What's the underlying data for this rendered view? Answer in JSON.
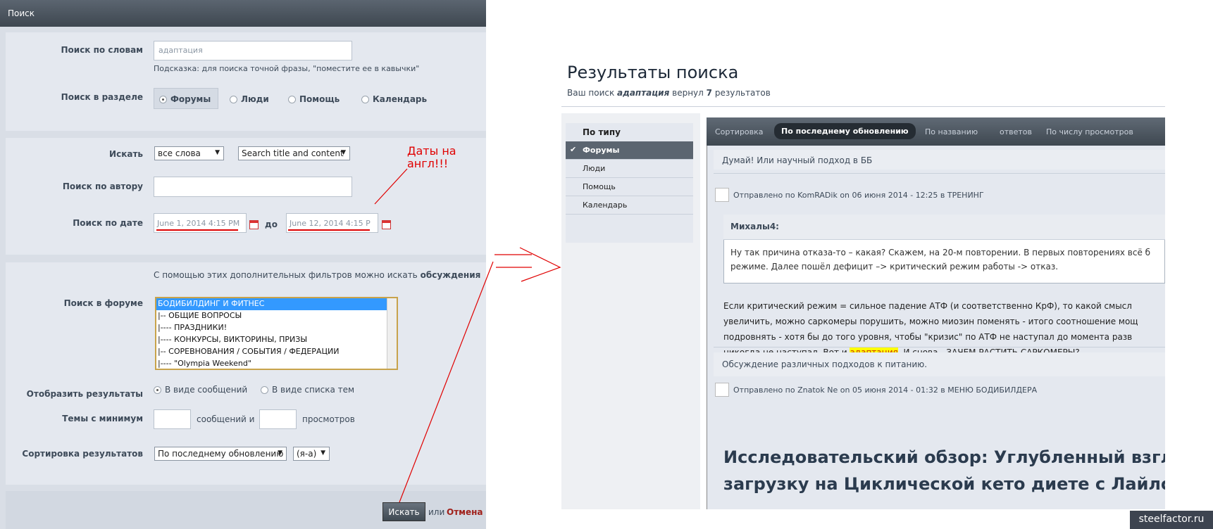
{
  "form": {
    "title": "Поиск",
    "words_label": "Поиск по словам",
    "words_value": "адаптация",
    "words_hint": "Подсказка: для поиска точной фразы, \"поместите ее в кавычки\"",
    "section_label": "Поиск в разделе",
    "sections": [
      "Форумы",
      "Люди",
      "Помощь",
      "Календарь"
    ],
    "search_label": "Искать",
    "search_mode": "все слова",
    "search_scope": "Search title and content",
    "author_label": "Поиск по автору",
    "author_value": "",
    "date_label": "Поиск по дате",
    "date_from": "June 1, 2014 4:15 PM",
    "date_to_label": "до",
    "date_to": "June 12, 2014 4:15 P",
    "filters_note": "С помощью этих дополнительных фильтров можно искать",
    "filters_note_bold": "обсуждения",
    "forum_label": "Поиск в форуме",
    "forums": [
      "БОДИБИЛДИНГ И ФИТНЕС",
      " |-- ОБЩИЕ ВОПРОСЫ",
      " |---- ПРАЗДНИКИ!",
      " |---- КОНКУРСЫ, ВИКТОРИНЫ, ПРИЗЫ",
      " |-- СОРЕВНОВАНИЯ / СОБЫТИЯ / ФЕДЕРАЦИИ",
      " |---- \"Olympia Weekend\""
    ],
    "display_label": "Отобразить результаты",
    "display_options": [
      "В виде сообщений",
      "В виде списка тем"
    ],
    "min_label": "Темы с минимум",
    "min_posts_suffix": "сообщений и",
    "min_views_suffix": "просмотров",
    "sort_label": "Сортировка результатов",
    "sort_value": "По последнему обновлению",
    "sort_order": "(я-а)",
    "search_button": "Искать",
    "or_text": "или",
    "cancel_link": "Отмена"
  },
  "annotation": {
    "line1": "Даты на",
    "line2": "англ!!!"
  },
  "results": {
    "title": "Результаты поиска",
    "summary_prefix": "Ваш поиск",
    "summary_query": "адаптация",
    "summary_mid": "вернул",
    "summary_count": "7",
    "summary_suffix": "результатов",
    "tabs_header": "По типу",
    "tabs": [
      "Форумы",
      "Люди",
      "Помощь",
      "Календарь"
    ],
    "sort_label": "Сортировка",
    "sort_active": "По последнему обновлению",
    "sort_options": [
      "По названию",
      "ответов",
      "По числу просмотров"
    ],
    "post1": {
      "title": "Думай! Или научный подход в ББ",
      "meta": "Отправлено по KomRADik on 06 июня 2014 - 12:25 в ТРЕНИНГ",
      "quote_author": "Михалы4:",
      "quote_line1": "Ну так причина отказа-то – какая? Скажем, на 20-м повторении. В первых повторениях всё б",
      "quote_line2": "режиме. Далее пошёл дефицит –> критический режим работы -> отказ.",
      "body_line1": "Если критический режим = сильное падение АТФ (и соответственно КрФ), то какой смысл",
      "body_line2": "увеличить, можно саркомеры порушить, можно миозин поменять - итого соотношение мощ",
      "body_line3": "подровнять - хотя бы до того уровня, чтобы \"кризис\" по АТФ не наступал до момента разв",
      "body_line4_pre": "никогда не наступал. Вот и",
      "body_line4_hl": "адаптация",
      "body_line4_post": ". И снова - ЗАЧЕМ РАСТИТЬ САРКОМЕРЫ?"
    },
    "post2": {
      "title": "Обсуждение различных подходов к питанию.",
      "meta": "Отправлено по Znatok Ne on 05 июня 2014 - 01:32 в МЕНЮ БОДИБИЛДЕРА",
      "headline_line1": "Исследовательский обзор: Углубленный взгл",
      "headline_line2": "загрузку на Циклической кето диете с Лайло"
    }
  },
  "watermark": "steelfactor.ru"
}
